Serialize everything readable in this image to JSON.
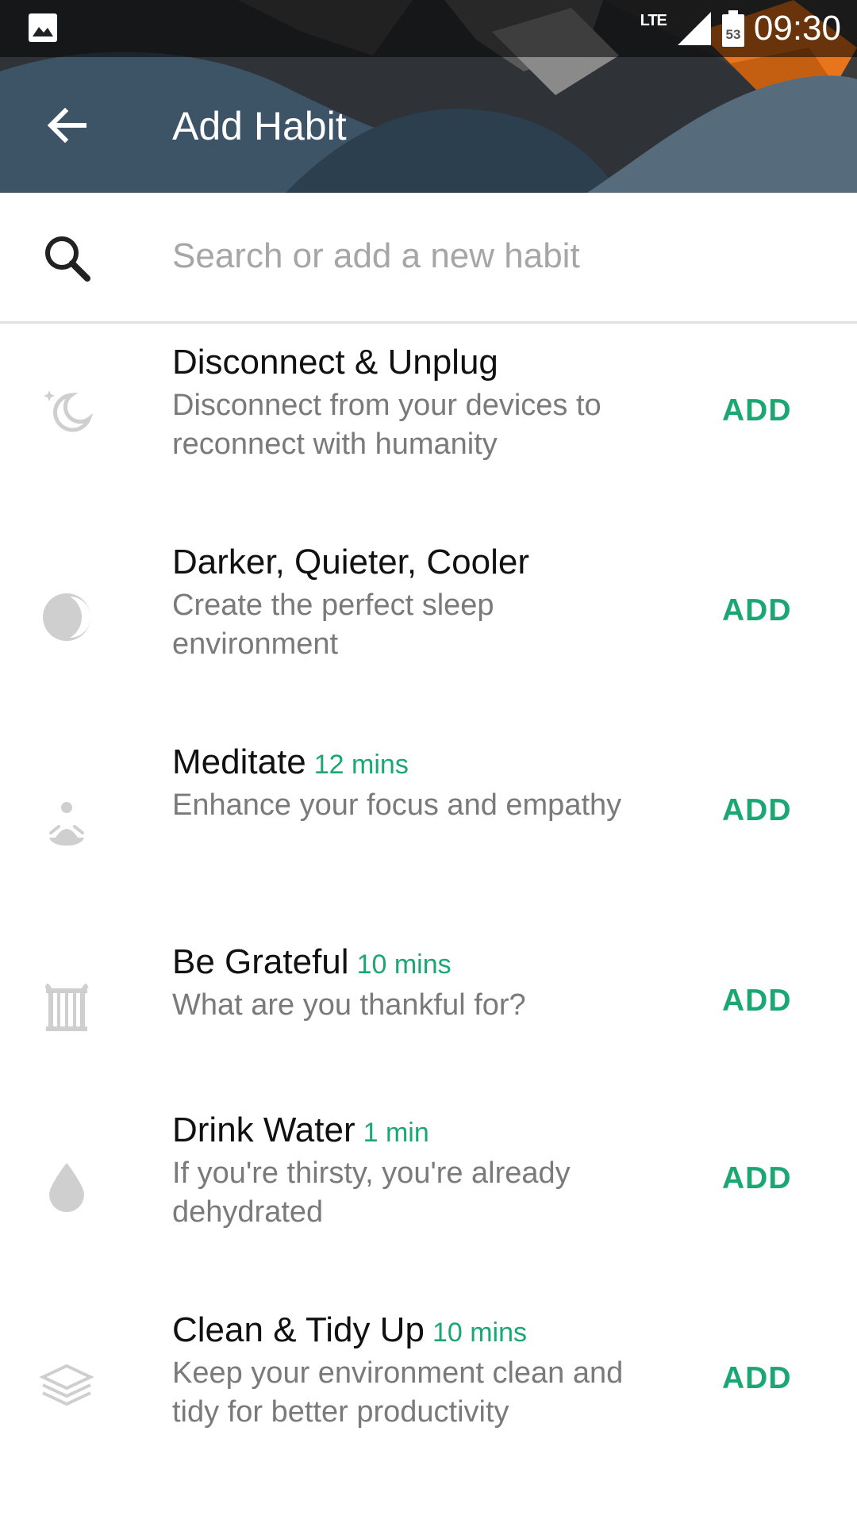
{
  "status_bar": {
    "time": "09:30",
    "network": "LTE",
    "battery": "53"
  },
  "app_bar": {
    "title": "Add Habit"
  },
  "search": {
    "placeholder": "Search or add a new habit"
  },
  "habits": [
    {
      "name": "Disconnect & Unplug",
      "duration": "",
      "description": "Disconnect from your devices to reconnect with humanity",
      "icon": "moon-stars-icon",
      "action": "ADD"
    },
    {
      "name": "Darker, Quieter, Cooler",
      "duration": "",
      "description": "Create the perfect sleep environment",
      "icon": "half-moon-icon",
      "action": "ADD"
    },
    {
      "name": "Meditate",
      "duration": "12 mins",
      "description": "Enhance your focus and empathy",
      "icon": "meditation-icon",
      "action": "ADD"
    },
    {
      "name": "Be Grateful",
      "duration": "10 mins",
      "description": "What are you thankful for?",
      "icon": "lyre-icon",
      "action": "ADD"
    },
    {
      "name": "Drink Water",
      "duration": "1 min",
      "description": "If you're thirsty, you're already dehydrated",
      "icon": "water-drop-icon",
      "action": "ADD"
    },
    {
      "name": "Clean & Tidy Up",
      "duration": "10 mins",
      "description": "Keep your environment clean and tidy for better productivity",
      "icon": "layers-icon",
      "action": "ADD"
    }
  ],
  "colors": {
    "accent": "#1aa774",
    "header_blue": "#3d5366",
    "header_orange": "#e8741c"
  }
}
